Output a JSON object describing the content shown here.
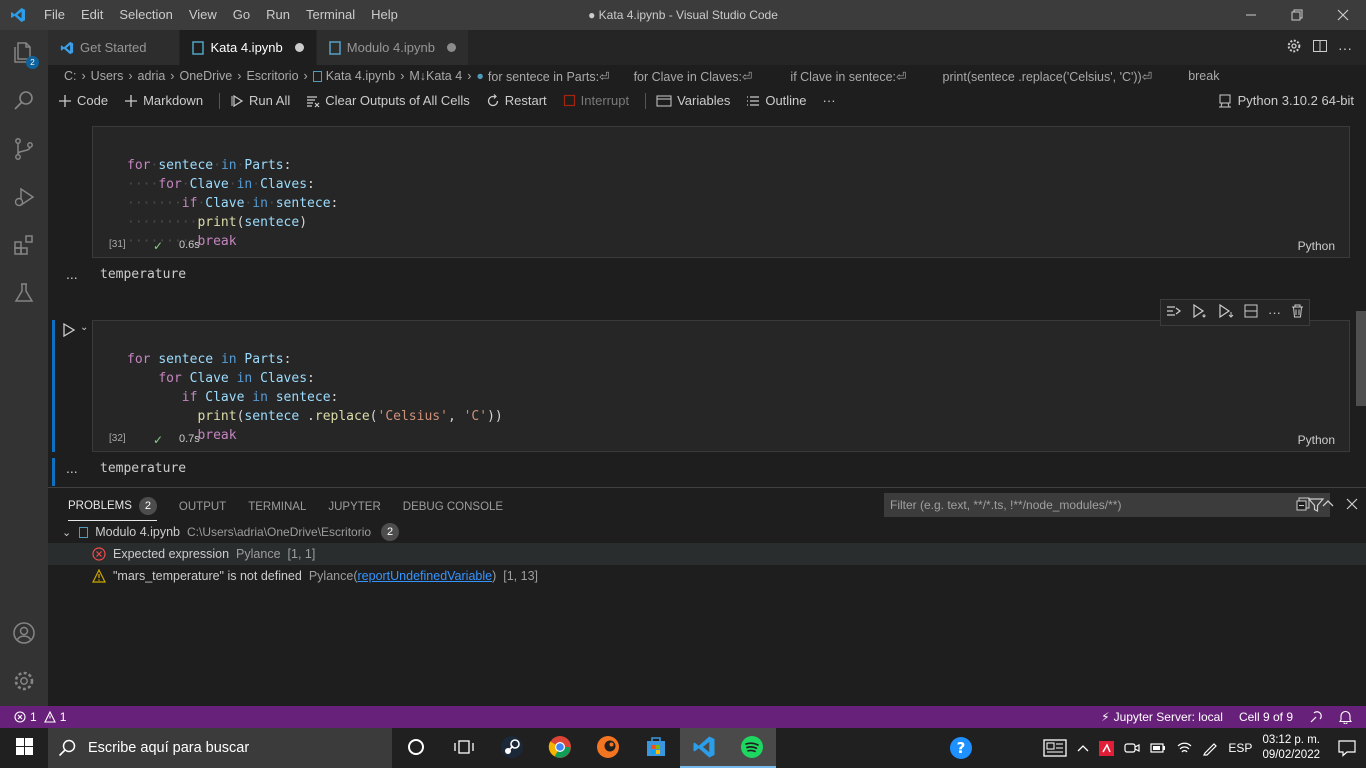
{
  "window": {
    "title": "● Kata 4.ipynb - Visual Studio Code",
    "menus": [
      "File",
      "Edit",
      "Selection",
      "View",
      "Go",
      "Run",
      "Terminal",
      "Help"
    ]
  },
  "activity_bar": {
    "explorer_badge": "2",
    "items": [
      "files-icon",
      "search-icon",
      "source-control-icon",
      "run-debug-icon",
      "extensions-icon",
      "testing-icon"
    ],
    "bottom": [
      "account-icon",
      "manage-gear-icon"
    ]
  },
  "tabs": [
    {
      "label": "Get Started",
      "active": false,
      "dirty": false
    },
    {
      "label": "Kata 4.ipynb",
      "active": true,
      "dirty": true
    },
    {
      "label": "Modulo 4.ipynb",
      "active": false,
      "dirty": true
    }
  ],
  "breadcrumb": {
    "path": [
      "C:",
      "Users",
      "adria",
      "OneDrive",
      "Escritorio",
      "Kata 4.ipynb",
      "M↓Kata 4",
      "for sentece in Parts:⏎"
    ],
    "extra": [
      "for Clave in Claves:⏎",
      "if Clave in sentece:⏎",
      "print(sentece .replace('Celsius', 'C'))⏎",
      "break"
    ]
  },
  "toolbar": {
    "code": "Code",
    "markdown": "Markdown",
    "run_all": "Run All",
    "clear_outputs": "Clear Outputs of All Cells",
    "restart": "Restart",
    "interrupt": "Interrupt",
    "variables": "Variables",
    "outline": "Outline",
    "more": "···",
    "kernel": "Python 3.10.2 64-bit"
  },
  "cells": [
    {
      "exec_count": "[31]",
      "duration": "0.6s",
      "language": "Python",
      "code": {
        "l1": {
          "kw": "for",
          "v1": "sentece",
          "in": "in",
          "v2": "Parts",
          "end": ":"
        },
        "l2": {
          "kw": "for",
          "v1": "Clave",
          "in": "in",
          "v2": "Claves",
          "end": ":"
        },
        "l3": {
          "kw": "if",
          "v1": "Clave",
          "in": "in",
          "v2": "sentece",
          "end": ":"
        },
        "l4": {
          "fn": "print",
          "open": "(",
          "arg": "sentece",
          "close": ")"
        },
        "l5": {
          "kw": "break"
        }
      },
      "output": "temperature"
    },
    {
      "exec_count": "[32]",
      "duration": "0.7s",
      "language": "Python",
      "code": {
        "l1": {
          "kw": "for",
          "v1": "sentece",
          "in": "in",
          "v2": "Parts",
          "end": ":"
        },
        "l2": {
          "kw": "for",
          "v1": "Clave",
          "in": "in",
          "v2": "Claves",
          "end": ":"
        },
        "l3": {
          "kw": "if",
          "v1": "Clave",
          "in": "in",
          "v2": "sentece",
          "end": ":"
        },
        "l4": {
          "fn": "print",
          "open": "(",
          "arg": "sentece",
          "mid": " .",
          "fn2": "replace",
          "open2": "(",
          "s1": "'Celsius'",
          "comma": ", ",
          "s2": "'C'",
          "close": "))"
        },
        "l5": {
          "kw": "break"
        }
      },
      "output": "temperature"
    }
  ],
  "output_dots": "...",
  "panel": {
    "tabs": [
      "PROBLEMS",
      "OUTPUT",
      "TERMINAL",
      "JUPYTER",
      "DEBUG CONSOLE"
    ],
    "problems_count": "2",
    "filter_placeholder": "Filter (e.g. text, **/*.ts, !**/node_modules/**)",
    "file": {
      "name": "Modulo 4.ipynb",
      "path": "C:\\Users\\adria\\OneDrive\\Escritorio",
      "count": "2"
    },
    "problems": [
      {
        "severity": "error",
        "message": "Expected expression",
        "source": "Pylance",
        "position": "[1, 1]"
      },
      {
        "severity": "warning",
        "message": "\"mars_temperature\" is not defined",
        "source": "Pylance",
        "link": "reportUndefinedVariable",
        "position": "[1, 13]"
      }
    ]
  },
  "status_bar": {
    "errors": "1",
    "warnings": "1",
    "jupyter_server": "Jupyter Server: local",
    "cell_position": "Cell 9 of 9"
  },
  "taskbar": {
    "search_placeholder": "Escribe aquí para buscar",
    "language": "ESP",
    "time": "03:12 p. m.",
    "date": "09/02/2022"
  },
  "colors": {
    "status_bar": "#68217a",
    "accent": "#0e70c0",
    "error": "#f14c4c",
    "warning": "#cca700",
    "success": "#89d185"
  }
}
